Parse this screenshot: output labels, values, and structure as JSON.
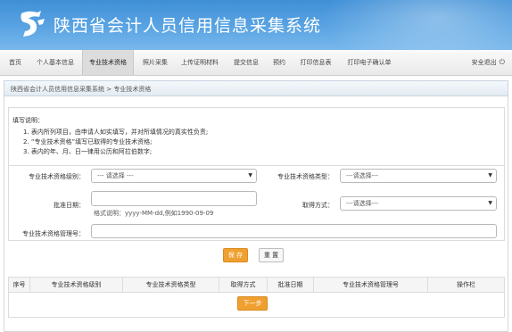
{
  "header": {
    "title": "陕西省会计人员信用信息采集系统",
    "logo_icon": "shaanxi-logo-icon"
  },
  "nav": {
    "items": [
      {
        "label": "首页"
      },
      {
        "label": "个人基本信息"
      },
      {
        "label": "专业技术资格",
        "active": true
      },
      {
        "label": "照片采集"
      },
      {
        "label": "上传证明材料"
      },
      {
        "label": "提交信息"
      },
      {
        "label": "预约"
      },
      {
        "label": "打印信息表"
      },
      {
        "label": "打印电子确认单"
      }
    ],
    "logout_label": "安全退出",
    "logout_icon": "power-icon"
  },
  "breadcrumb": "陕西省会计人员信用信息采集系统 > 专业技术资格",
  "notes": {
    "title": "填写说明：",
    "lines": [
      "1. 表内所列项目，由申请人如实填写，并对所填情况的真实性负责;",
      "2. “专业技术资格”填写已取得的专业技术资格;",
      "3. 表内的年、月、日一律用公历和阿拉伯数字;"
    ]
  },
  "form": {
    "level_label": "专业技术资格级别：",
    "level_value": "--- 请选择 ---",
    "type_label": "专业技术资格类型：",
    "type_value": "---请选择---",
    "date_label": "批准日期：",
    "date_value": "",
    "date_hint": "格式说明：yyyy-MM-dd,例如1990-09-09",
    "method_label": "取得方式：",
    "method_value": "---请选择---",
    "mgmt_label": "专业技术资格管理号：",
    "mgmt_value": ""
  },
  "buttons": {
    "save": "保 存",
    "reset": "重 置",
    "next": "下一步"
  },
  "table": {
    "headers": [
      "序号",
      "专业技术资格级别",
      "专业技术资格类型",
      "取得方式",
      "批准日期",
      "专业技术资格管理号",
      "操作栏"
    ]
  },
  "colors": {
    "banner": "#4a98dc",
    "accent": "#f0a030"
  }
}
